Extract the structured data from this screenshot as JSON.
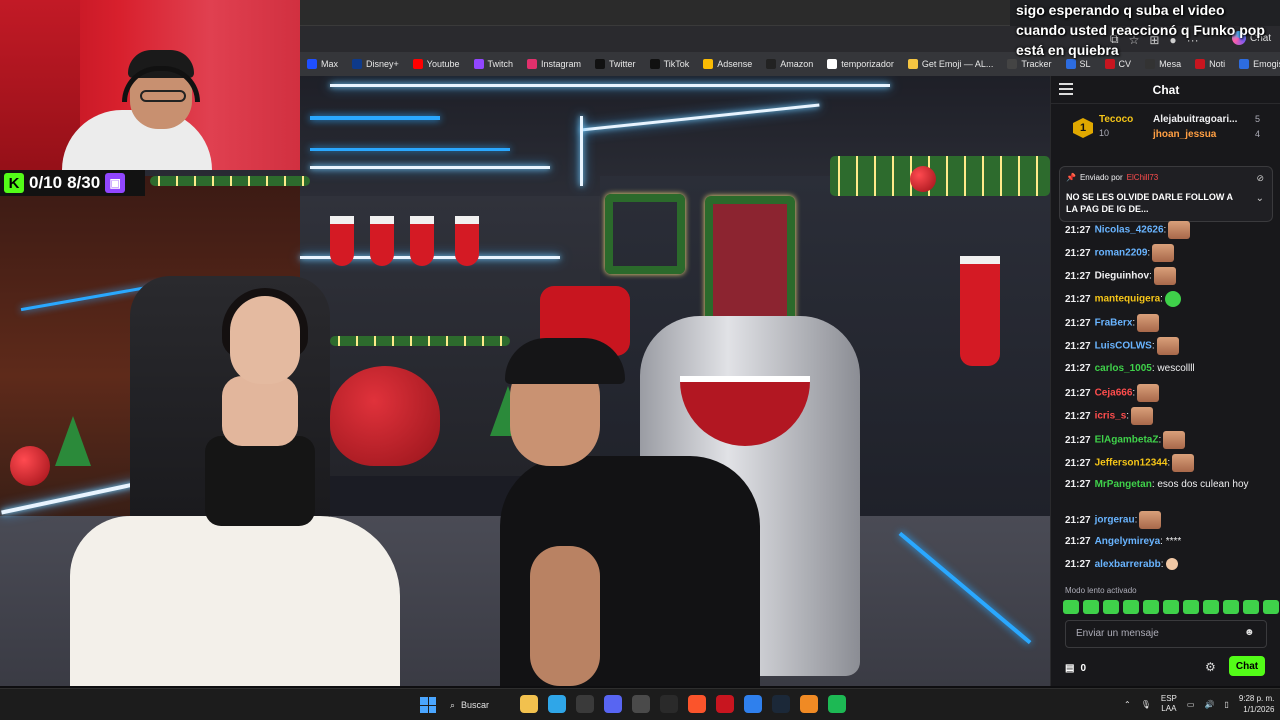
{
  "overlay": {
    "caption": "sigo esperando q suba el video\ncuando usted reaccionó q Funko pop\nestá en quiebra"
  },
  "browser": {
    "chat_button_label": "Chat",
    "bookmarks": [
      {
        "label": "Max",
        "color": "#1f4fff"
      },
      {
        "label": "Disney+",
        "color": "#0e3a8a"
      },
      {
        "label": "Youtube",
        "color": "#ff0000"
      },
      {
        "label": "Twitch",
        "color": "#9146ff"
      },
      {
        "label": "Instagram",
        "color": "#e1306c"
      },
      {
        "label": "Twitter",
        "color": "#111111"
      },
      {
        "label": "TikTok",
        "color": "#111111"
      },
      {
        "label": "Adsense",
        "color": "#fbbc04"
      },
      {
        "label": "Amazon",
        "color": "#222222"
      },
      {
        "label": "temporizador",
        "color": "#ffffff"
      },
      {
        "label": "Get Emoji — AL...",
        "color": "#f5c542"
      },
      {
        "label": "Tracker",
        "color": "#444444"
      },
      {
        "label": "SL",
        "color": "#2d6cdf"
      },
      {
        "label": "CV",
        "color": "#c8151f"
      },
      {
        "label": "Mesa",
        "color": "#333333"
      },
      {
        "label": "Noti",
        "color": "#c8151f"
      },
      {
        "label": "Emogis",
        "color": "#2d6cdf"
      }
    ]
  },
  "stream_overlay": {
    "kick_count": "0/10",
    "twitch_count": "8/30",
    "kick_logo": "K"
  },
  "chat": {
    "title": "Chat",
    "leaderboard": {
      "rank": "1",
      "first": {
        "name": "Tecoco",
        "count": "10",
        "color": "#f5c518"
      },
      "second": {
        "name": "Alejabuitragoari...",
        "count": "5",
        "color": "#efeff1"
      },
      "third": {
        "name": "jhoan_jessua",
        "count": "4",
        "color": "#ff9f43"
      }
    },
    "pinned": {
      "sent_by_label": "Enviado por",
      "sender": "ElChill73",
      "sender_color": "#ff4d4d",
      "message": "NO SE LES OLVIDE DARLE FOLLOW A LA PAG DE IG DE..."
    },
    "messages": [
      {
        "time": "21:27",
        "user": "Nicolas_42626",
        "color": "#69b4ff",
        "text": ":",
        "emote": "face"
      },
      {
        "time": "21:27",
        "user": "roman2209",
        "color": "#69b4ff",
        "text": ":",
        "emote": "face"
      },
      {
        "time": "21:27",
        "user": "Dieguinhov",
        "color": "#efeff1",
        "text": ":",
        "emote": "face"
      },
      {
        "time": "21:27",
        "user": "mantequigera",
        "color": "#f5c518",
        "text": ":",
        "emote": "green"
      },
      {
        "time": "21:27",
        "user": "FraBerx",
        "color": "#69b4ff",
        "text": ":",
        "emote": "face"
      },
      {
        "time": "21:27",
        "user": "LuisCOLWS",
        "color": "#69b4ff",
        "text": ":",
        "emote": "face"
      },
      {
        "time": "21:27",
        "user": "carlos_1005",
        "color": "#3fd14a",
        "text": ": wescollll",
        "emote": ""
      },
      {
        "time": "21:27",
        "user": "Ceja666",
        "color": "#ff4d4d",
        "text": ":",
        "emote": "face"
      },
      {
        "time": "21:27",
        "user": "icris_s",
        "color": "#ff4d4d",
        "text": ":",
        "emote": "face"
      },
      {
        "time": "21:27",
        "user": "ElAgambetaZ",
        "color": "#3fd14a",
        "text": ":",
        "emote": "face"
      },
      {
        "time": "21:27",
        "user": "Jefferson12344",
        "color": "#f5c518",
        "text": ":",
        "emote": "face"
      },
      {
        "time": "21:27",
        "user": "MrPangetan",
        "color": "#3fd14a",
        "text": ": esos dos culean hoy",
        "emote": ""
      },
      {
        "time": "21:27",
        "user": "jorgerau",
        "color": "#69b4ff",
        "text": ":",
        "emote": "face"
      },
      {
        "time": "21:27",
        "user": "Angelymireya",
        "color": "#69b4ff",
        "text": ": ****",
        "emote": ""
      },
      {
        "time": "21:27",
        "user": "alexbarrerabb",
        "color": "#69b4ff",
        "text": ":",
        "emote": "hand"
      }
    ],
    "slow_mode": "Modo lento activado",
    "input_placeholder": "Enviar un mensaje",
    "points": "0",
    "send_label": "Chat"
  },
  "taskbar": {
    "search_label": "Buscar",
    "language": "ESP",
    "region": "LAA",
    "time": "9:28 p. m.",
    "date": "1/1/2026",
    "apps": [
      {
        "name": "file-explorer-icon",
        "color": "#f2c14e"
      },
      {
        "name": "edge-icon",
        "color": "#2fa6e8"
      },
      {
        "name": "store-icon",
        "color": "#3a3a3a"
      },
      {
        "name": "discord-icon",
        "color": "#5865f2"
      },
      {
        "name": "clock-app-icon",
        "color": "#4a4a4a"
      },
      {
        "name": "epic-games-icon",
        "color": "#2a2a2a"
      },
      {
        "name": "brave-icon",
        "color": "#fb542b"
      },
      {
        "name": "red-app-icon",
        "color": "#c8151f"
      },
      {
        "name": "vscode-icon",
        "color": "#2f80ed"
      },
      {
        "name": "steam-icon",
        "color": "#1b2838"
      },
      {
        "name": "vlc-icon",
        "color": "#f08a24"
      },
      {
        "name": "spotify-icon",
        "color": "#1db954"
      }
    ]
  }
}
